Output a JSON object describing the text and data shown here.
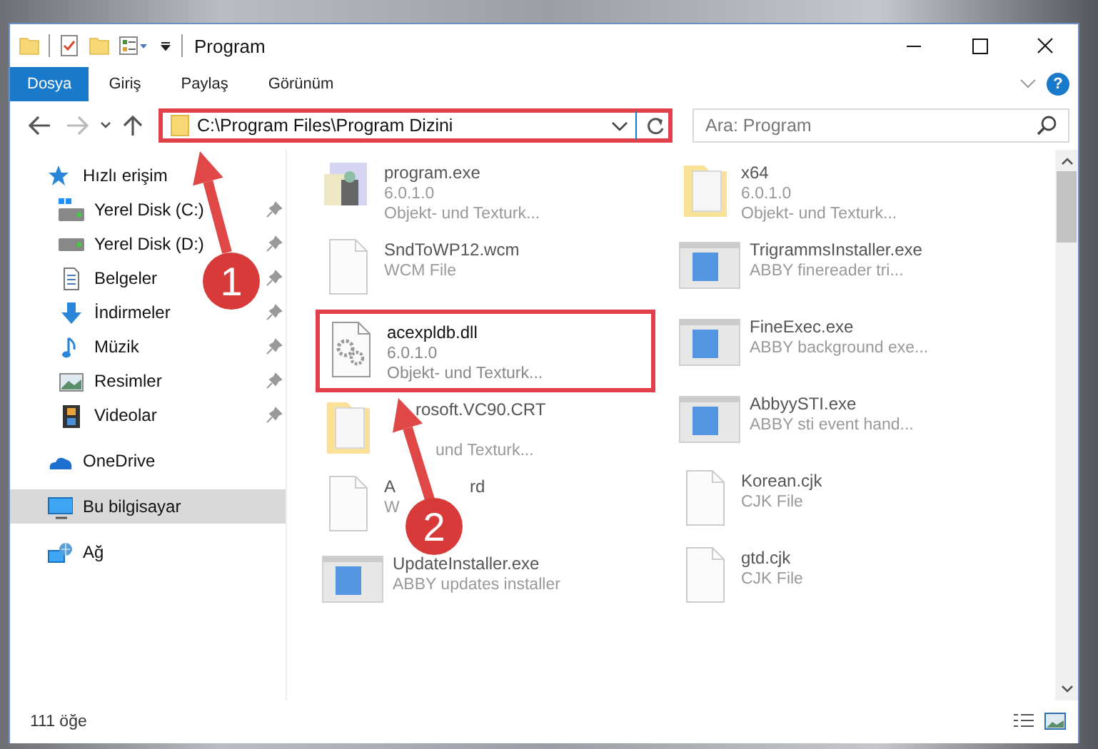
{
  "window": {
    "title": "Program"
  },
  "ribbon": {
    "tabs": [
      {
        "label": "Dosya",
        "selected": true
      },
      {
        "label": "Giriş",
        "selected": false
      },
      {
        "label": "Paylaş",
        "selected": false
      },
      {
        "label": "Görünüm",
        "selected": false
      }
    ],
    "help": "?"
  },
  "address_bar": {
    "path": "C:\\Program Files\\Program Dizini",
    "highlighted": true
  },
  "search": {
    "placeholder": "Ara: Program"
  },
  "sidebar": {
    "items": [
      {
        "label": "Hızlı erişim",
        "kind": "star",
        "selected": false,
        "children": [
          {
            "label": "Yerel Disk (C:)",
            "kind": "system-drive",
            "selected": false,
            "pinned": true
          },
          {
            "label": "Yerel Disk (D:)",
            "kind": "drive",
            "selected": false,
            "pinned": true
          },
          {
            "label": "Belgeler",
            "kind": "document",
            "selected": false,
            "pinned": true
          },
          {
            "label": "İndirmeler",
            "kind": "download",
            "selected": false,
            "pinned": true
          },
          {
            "label": "Müzik",
            "kind": "music",
            "selected": false,
            "pinned": true
          },
          {
            "label": "Resimler",
            "kind": "pictures",
            "selected": false,
            "pinned": true
          },
          {
            "label": "Videolar",
            "kind": "video",
            "selected": false,
            "pinned": true
          }
        ]
      },
      {
        "label": "OneDrive",
        "kind": "cloud",
        "selected": false
      },
      {
        "label": "Bu bilgisayar",
        "kind": "computer",
        "selected": true
      },
      {
        "label": "Ağ",
        "kind": "network",
        "selected": false
      }
    ]
  },
  "files": {
    "columns": [
      [
        {
          "name": "program.exe",
          "lines": [
            "6.0.1.0",
            "Objekt- und Texturk..."
          ],
          "kind": "program",
          "blurred": true,
          "highlighted": false
        },
        {
          "name": "SndToWP12.wcm",
          "lines": [
            "WCM File"
          ],
          "kind": "blank",
          "blurred": true,
          "highlighted": false
        },
        {
          "name": "acexpldb.dll",
          "lines": [
            "6.0.1.0",
            "Objekt- und Texturk..."
          ],
          "kind": "gears",
          "blurred": false,
          "highlighted": true
        },
        {
          "name": "rosoft.VC90.CRT",
          "lines": [
            "und Texturk..."
          ],
          "kind": "folder",
          "blurred": true,
          "highlighted": false,
          "covered": true
        },
        {
          "name_parts": [
            "A",
            "rd"
          ],
          "lines": [
            "W"
          ],
          "kind": "blank",
          "blurred": true,
          "highlighted": false
        },
        {
          "name": "UpdateInstaller.exe",
          "lines": [
            "ABBY updates installer"
          ],
          "kind": "app",
          "blurred": true,
          "highlighted": false
        }
      ],
      [
        {
          "name": "x64",
          "lines": [
            "6.0.1.0",
            "Objekt- und Texturk..."
          ],
          "kind": "folder",
          "blurred": true,
          "highlighted": false
        },
        {
          "name": "TrigrammsInstaller.exe",
          "lines": [
            "ABBY finereader tri..."
          ],
          "kind": "app",
          "blurred": true,
          "highlighted": false
        },
        {
          "name": "FineExec.exe",
          "lines": [
            "ABBY background exe..."
          ],
          "kind": "app",
          "blurred": true,
          "highlighted": false
        },
        {
          "name": "AbbyySTI.exe",
          "lines": [
            "ABBY sti event hand..."
          ],
          "kind": "app",
          "blurred": true,
          "highlighted": false
        },
        {
          "name": "Korean.cjk",
          "lines": [
            "CJK File"
          ],
          "kind": "blank",
          "blurred": true,
          "highlighted": false
        },
        {
          "name": "gtd.cjk",
          "lines": [
            "CJK File"
          ],
          "kind": "blank",
          "blurred": true,
          "highlighted": false
        }
      ]
    ]
  },
  "status_bar": {
    "count": "111 öğe"
  },
  "markers": [
    {
      "label": "1"
    },
    {
      "label": "2"
    }
  ]
}
